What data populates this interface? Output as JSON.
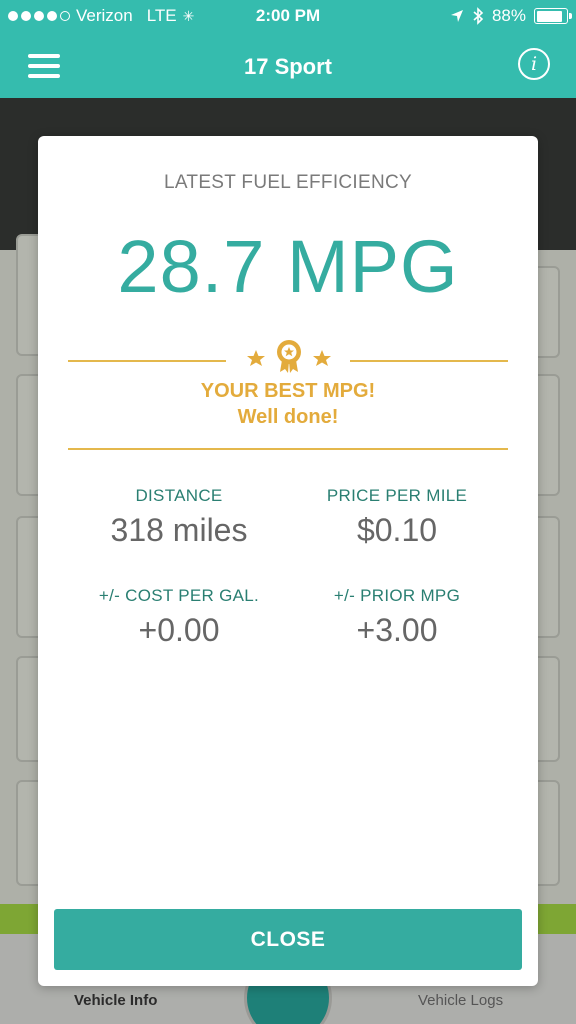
{
  "status_bar": {
    "carrier": "Verizon",
    "network": "LTE",
    "time": "2:00 PM",
    "battery_percent": "88%",
    "battery_level": 0.88
  },
  "nav_bar": {
    "title": "17 Sport",
    "menu_icon": "menu-icon",
    "info_icon": "info-icon"
  },
  "tab_bar": {
    "left_label": "Vehicle Info",
    "right_label": "Vehicle Logs"
  },
  "modal": {
    "heading": "LATEST FUEL EFFICIENCY",
    "mpg": "28.7 MPG",
    "badge_icon": "award-ribbon-icon",
    "best_title": "YOUR BEST MPG!",
    "best_subtitle": "Well done!",
    "stats": [
      {
        "label": "DISTANCE",
        "value": "318 miles"
      },
      {
        "label": "PRICE PER MILE",
        "value": "$0.10"
      },
      {
        "label": "+/- COST PER GAL.",
        "value": "+0.00"
      },
      {
        "label": "+/- PRIOR MPG",
        "value": "+3.00"
      }
    ],
    "close_label": "CLOSE"
  },
  "colors": {
    "teal": "#35bcae",
    "modal_teal": "#35aca0",
    "gold": "#e3ab3c",
    "label_green": "#2a7f72"
  }
}
